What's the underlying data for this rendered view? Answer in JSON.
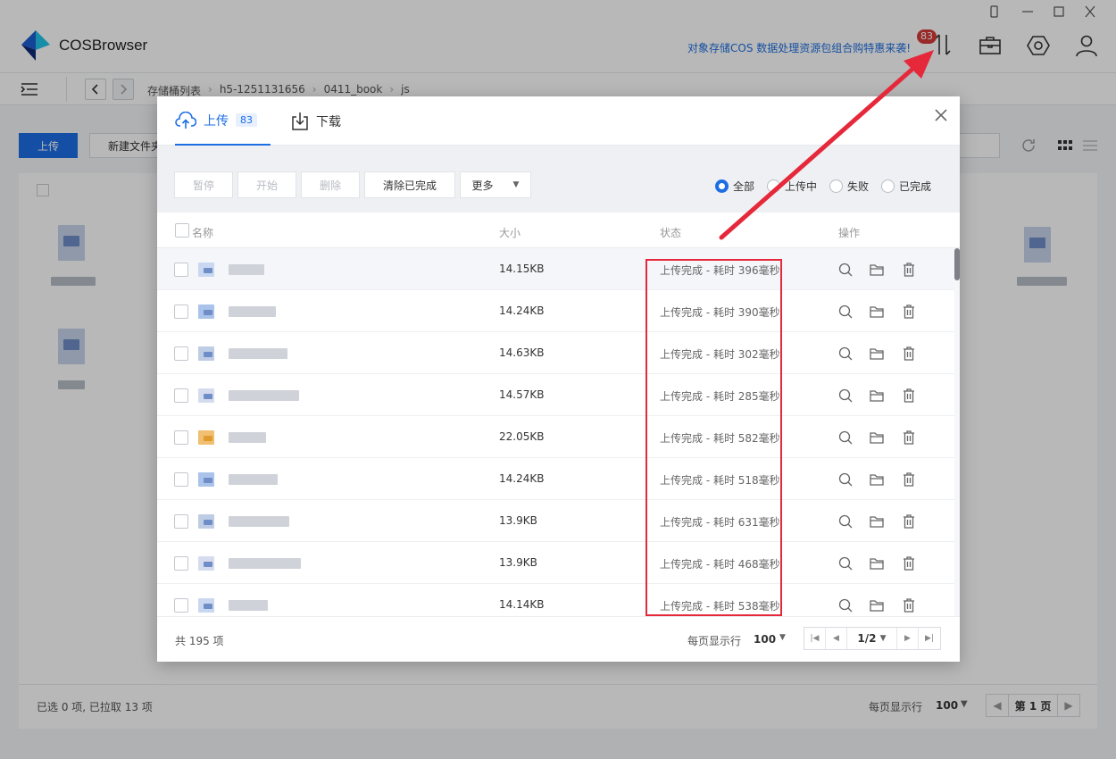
{
  "app": {
    "title": "COSBrowser",
    "promo": "对象存储COS 数据处理资源包组合购特惠来袭!",
    "transfer_badge": "83"
  },
  "nav": {
    "breadcrumb": [
      "存储桶列表",
      "h5-1251131656",
      "0411_book",
      "js"
    ]
  },
  "toolbar": {
    "upload_label": "上传",
    "newfolder_label": "新建文件夹"
  },
  "statusbar": {
    "selection": "已选 0 项, 已拉取 13 项",
    "per_page_label": "每页显示行",
    "per_page_value": "100",
    "page_label": "第 1 页"
  },
  "modal": {
    "tabs": {
      "upload_label": "上传",
      "upload_count": "83",
      "download_label": "下载"
    },
    "actions": {
      "pause": "暂停",
      "start": "开始",
      "delete": "删除",
      "clear_completed": "清除已完成",
      "more": "更多"
    },
    "filters": [
      "全部",
      "上传中",
      "失败",
      "已完成"
    ],
    "selected_filter": "全部",
    "columns": {
      "name": "名称",
      "size": "大小",
      "status": "状态",
      "actions": "操作"
    },
    "rows": [
      {
        "size": "14.15KB",
        "status": "上传完成 - 耗时 396毫秒"
      },
      {
        "size": "14.24KB",
        "status": "上传完成 - 耗时 390毫秒"
      },
      {
        "size": "14.63KB",
        "status": "上传完成 - 耗时 302毫秒"
      },
      {
        "size": "14.57KB",
        "status": "上传完成 - 耗时 285毫秒"
      },
      {
        "size": "22.05KB",
        "status": "上传完成 - 耗时 582毫秒"
      },
      {
        "size": "14.24KB",
        "status": "上传完成 - 耗时 518毫秒"
      },
      {
        "size": "13.9KB",
        "status": "上传完成 - 耗时 631毫秒"
      },
      {
        "size": "13.9KB",
        "status": "上传完成 - 耗时 468毫秒"
      },
      {
        "size": "14.14KB",
        "status": "上传完成 - 耗时 538毫秒"
      }
    ],
    "footer": {
      "total": "共 195 项",
      "per_page_label": "每页显示行",
      "per_page_value": "100",
      "page": "1/2"
    }
  },
  "colors": {
    "accent": "#1d6ee5",
    "badge": "#d63a3a",
    "annotation": "#e5283a"
  }
}
